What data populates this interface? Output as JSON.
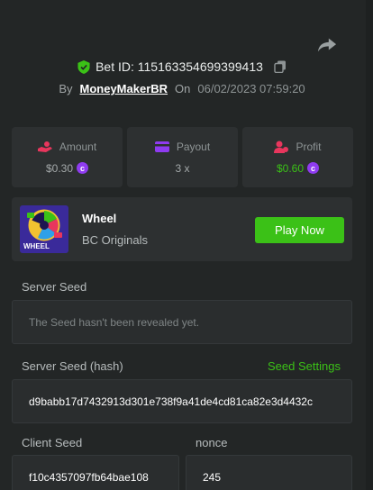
{
  "header": {
    "bet_id_label": "Bet ID: 115163354699399413",
    "by_label": "By",
    "username": "MoneyMakerBR",
    "on_label": "On",
    "datetime": "06/02/2023 07:59:20"
  },
  "stats": {
    "amount": {
      "label": "Amount",
      "value": "$0.30"
    },
    "payout": {
      "label": "Payout",
      "value": "3 x"
    },
    "profit": {
      "label": "Profit",
      "value": "$0.60"
    }
  },
  "game": {
    "name": "Wheel",
    "provider": "BC Originals",
    "thumb_text": "WHEEL",
    "play_label": "Play Now"
  },
  "seeds": {
    "server_seed_label": "Server Seed",
    "server_seed_placeholder": "The Seed hasn't been revealed yet.",
    "server_seed_hash_label": "Server Seed (hash)",
    "seed_settings_label": "Seed Settings",
    "server_seed_hash": "d9babb17d7432913d301e738f9a41de4cd81ca82e3d4432c",
    "client_seed_label": "Client Seed",
    "client_seed": "f10c4357097fb64bae108",
    "nonce_label": "nonce",
    "nonce": "245"
  },
  "colors": {
    "accent_green": "#3bc117",
    "coin_purple": "#8f3bf0",
    "shield_green": "#3bc117",
    "amount_icon": "#e8365d",
    "payout_icon": "#8f3bf0",
    "profit_icon": "#e8365d"
  },
  "icons": {
    "share": "share-icon",
    "shield": "shield-check-icon",
    "copy": "copy-icon",
    "amount": "coins-hand-icon",
    "payout": "card-icon",
    "profit": "user-coin-icon",
    "coin": "bc-coin-icon"
  }
}
